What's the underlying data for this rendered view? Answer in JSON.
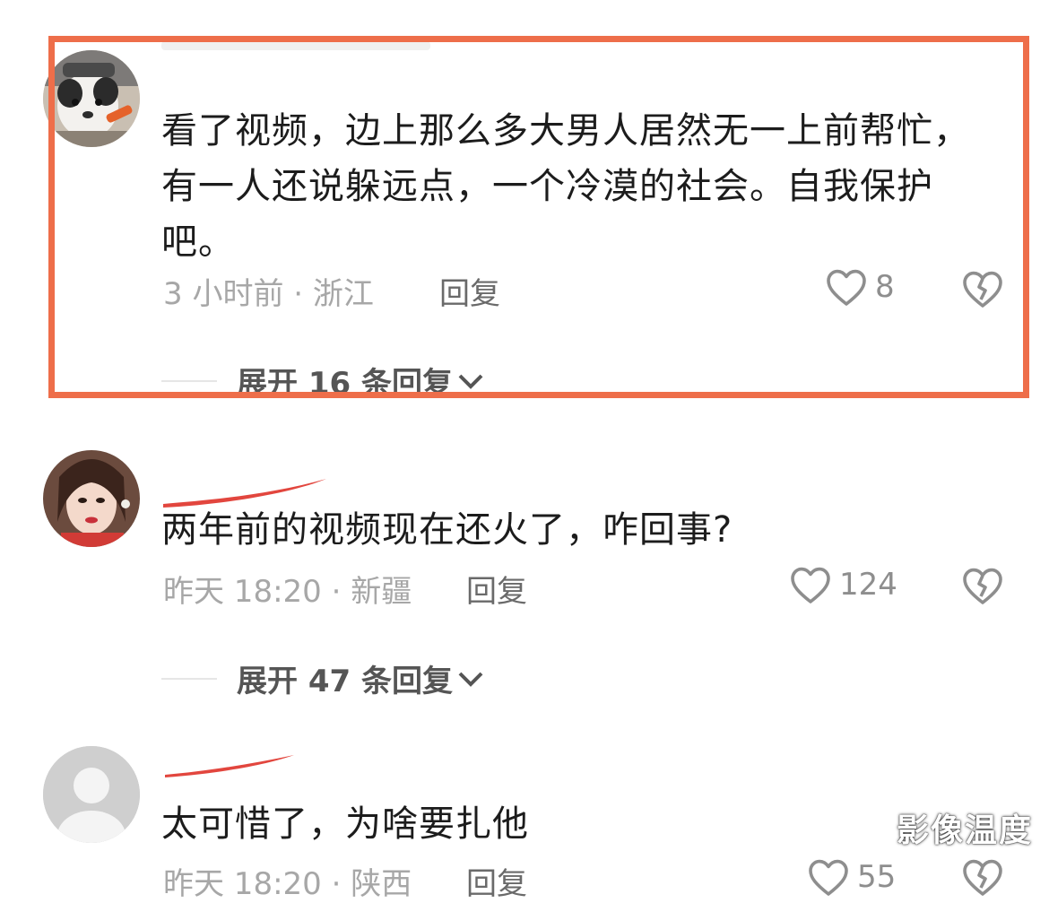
{
  "comments": [
    {
      "text": "看了视频，边上那么多大男人居然无一上前帮忙，有一人还说躲远点，一个冷漠的社会。自我保护吧。",
      "meta": "3 小时前 · 浙江",
      "reply_label": "回复",
      "likes": "8",
      "expand_label": "展开 16 条回复"
    },
    {
      "text": "两年前的视频现在还火了，咋回事?",
      "meta": "昨天 18:20 · 新疆",
      "reply_label": "回复",
      "likes": "124",
      "expand_label": "展开 47 条回复"
    },
    {
      "text": "太可惜了，为啥要扎他",
      "meta": "昨天 18:20 · 陕西",
      "reply_label": "回复",
      "likes": "55"
    }
  ],
  "icons": {
    "like": "heart-outline-icon",
    "dislike": "broken-heart-icon",
    "expand": "chevron-down-icon"
  },
  "colors": {
    "highlight_border": "#ee6e4a",
    "name_redaction": "#e2463e",
    "text": "#1c1c1c",
    "meta": "#a7a7a7"
  },
  "watermark": "影像温度"
}
